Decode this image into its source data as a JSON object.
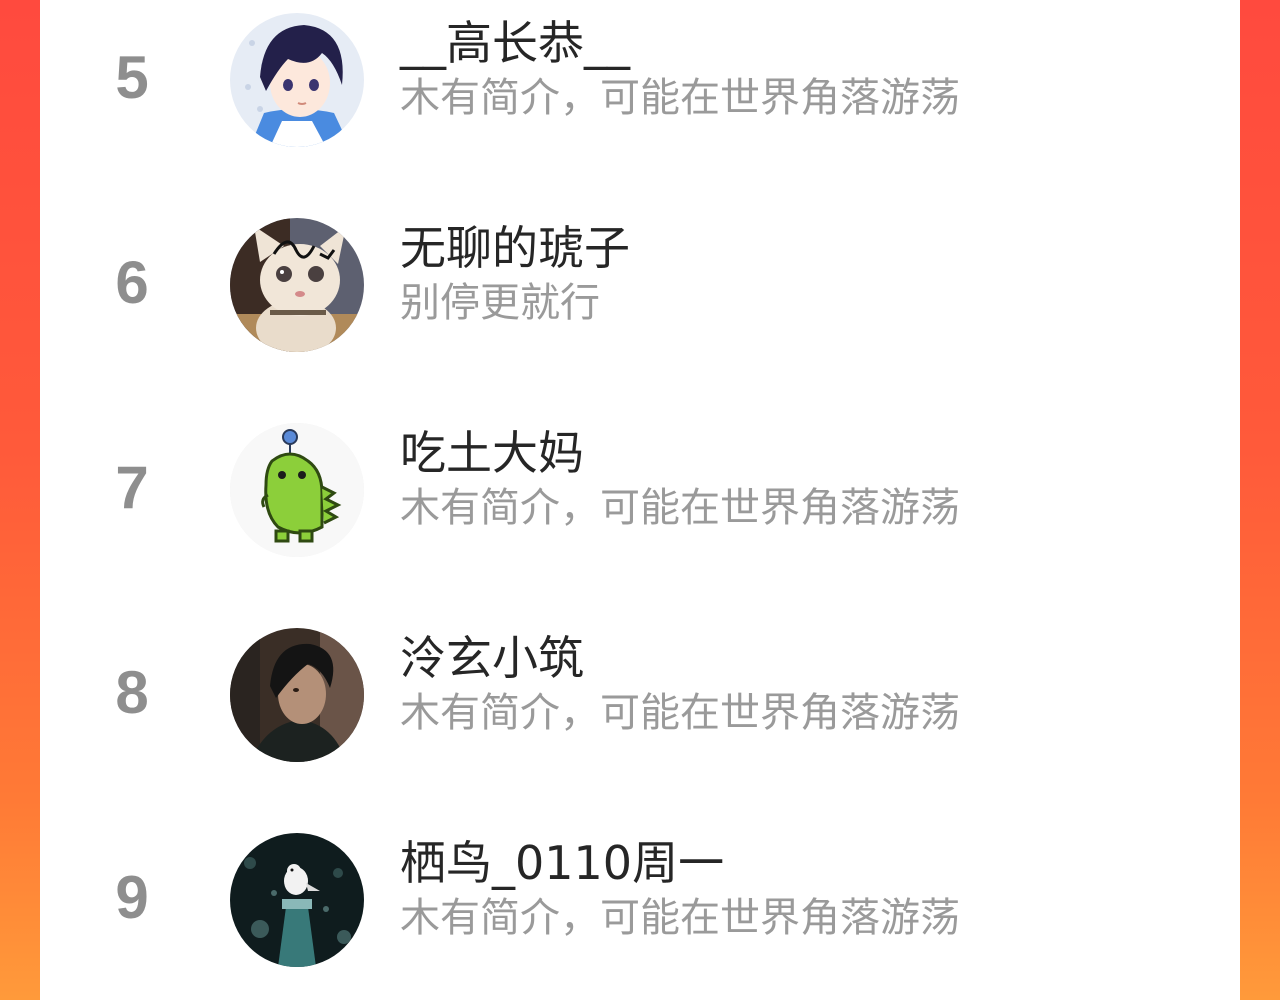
{
  "theme": {
    "accent_left": "#ff4a3e",
    "accent_right": "#ff9a3a",
    "panel": "#ffffff",
    "rank_color": "#8e8e8e",
    "name_color": "#262626",
    "bio_color": "#9a9a9a"
  },
  "ranking": {
    "entries": [
      {
        "rank": "5",
        "name": "__高长恭__",
        "bio": "木有简介，可能在世界角落游荡",
        "avatar": "anime-boy-avatar-icon"
      },
      {
        "rank": "6",
        "name": "无聊的琥子",
        "bio": "别停更就行",
        "avatar": "cat-avatar-icon"
      },
      {
        "rank": "7",
        "name": "吃土大妈",
        "bio": "木有简介，可能在世界角落游荡",
        "avatar": "green-dinosaur-avatar-icon"
      },
      {
        "rank": "8",
        "name": "泠玄小筑",
        "bio": "木有简介，可能在世界角落游荡",
        "avatar": "dark-portrait-avatar-icon"
      },
      {
        "rank": "9",
        "name": "栖鸟_0110周一",
        "bio": "木有简介，可能在世界角落游荡",
        "avatar": "bird-lantern-avatar-icon"
      }
    ]
  }
}
